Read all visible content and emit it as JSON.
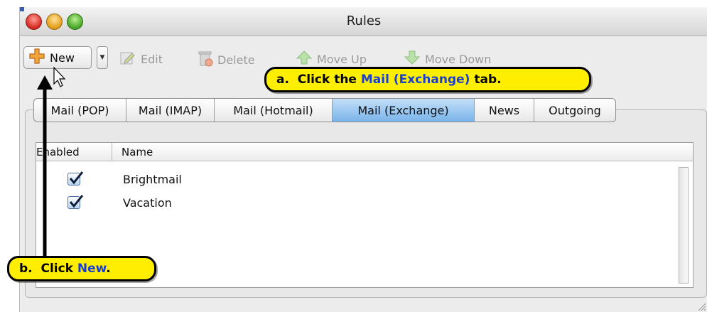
{
  "window": {
    "title": "Rules"
  },
  "toolbar": {
    "new_label": "New",
    "edit_label": "Edit",
    "delete_label": "Delete",
    "move_up_label": "Move Up",
    "move_down_label": "Move Down"
  },
  "tabs": [
    {
      "label": "Mail (POP)",
      "selected": false
    },
    {
      "label": "Mail (IMAP)",
      "selected": false
    },
    {
      "label": "Mail (Hotmail)",
      "selected": false
    },
    {
      "label": "Mail (Exchange)",
      "selected": true
    },
    {
      "label": "News",
      "selected": false
    },
    {
      "label": "Outgoing",
      "selected": false
    }
  ],
  "table": {
    "columns": [
      "Enabled",
      "Name"
    ],
    "rows": [
      {
        "enabled": true,
        "name": "Brightmail"
      },
      {
        "enabled": true,
        "name": "Vacation"
      }
    ]
  },
  "annotations": {
    "a": {
      "prefix": "a.  Click the ",
      "highlight": "Mail (Exchange)",
      "suffix": " tab."
    },
    "b": {
      "prefix": "b.  Click ",
      "highlight": "New",
      "suffix": "."
    }
  },
  "colors": {
    "callout_bg": "#ffee00",
    "callout_highlight": "#1a3fd0",
    "selected_tab": "#79b4ea"
  }
}
